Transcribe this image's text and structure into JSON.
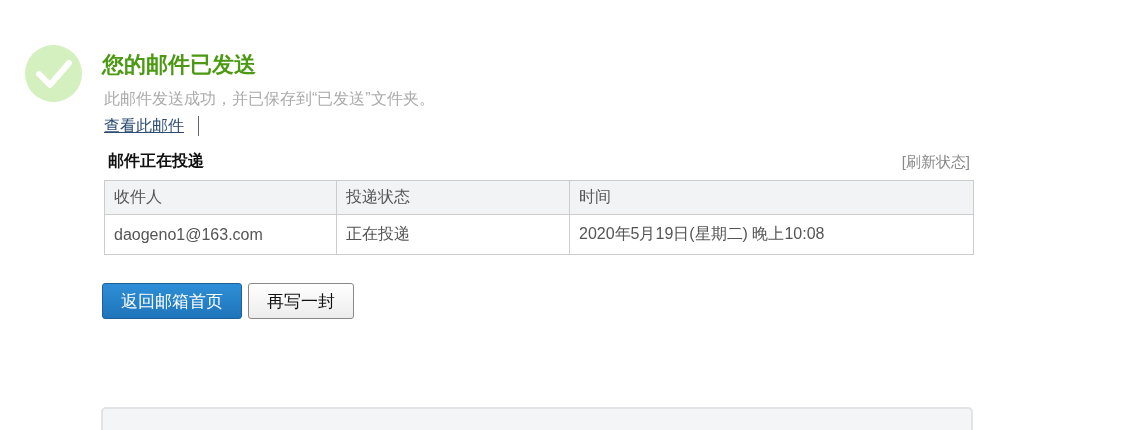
{
  "title": "您的邮件已发送",
  "message": "此邮件发送成功，并已保存到“已发送”文件夹。",
  "links": [
    "查看此邮件"
  ],
  "delivery": {
    "heading": "邮件正在投递",
    "refresh": "[刷新状态]",
    "columns": [
      "收件人",
      "投递状态",
      "时间"
    ],
    "rows": [
      [
        "daogeno1@163.com",
        "正在投递",
        "2020年5月19日(星期二) 晚上10:08"
      ]
    ]
  },
  "buttons": [
    {
      "label": "返回邮箱首页",
      "kind": "primary"
    },
    {
      "label": "再写一封",
      "kind": "secondary"
    }
  ]
}
